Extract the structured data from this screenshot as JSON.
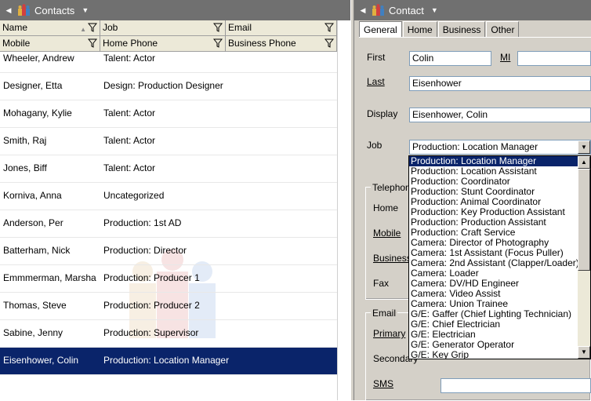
{
  "left": {
    "title": "Contacts",
    "header1": [
      {
        "label": "Name"
      },
      {
        "label": "Job"
      },
      {
        "label": "Email"
      }
    ],
    "header2": [
      {
        "label": "Mobile"
      },
      {
        "label": "Home Phone"
      },
      {
        "label": "Business Phone"
      }
    ],
    "rows": [
      {
        "name": "Wheeler, Andrew",
        "job": "Talent: Actor"
      },
      {
        "name": "Designer, Etta",
        "job": "Design: Production Designer"
      },
      {
        "name": "Mohagany, Kylie",
        "job": "Talent: Actor"
      },
      {
        "name": "Smith, Raj",
        "job": "Talent: Actor"
      },
      {
        "name": "Jones, Biff",
        "job": "Talent: Actor"
      },
      {
        "name": "Korniva, Anna",
        "job": "Uncategorized"
      },
      {
        "name": "Anderson, Per",
        "job": "Production: 1st AD"
      },
      {
        "name": "Batterham, Nick",
        "job": "Production: Director"
      },
      {
        "name": "Emmmerman, Marsha",
        "job": "Production: Producer 1"
      },
      {
        "name": "Thomas, Steve",
        "job": "Production: Producer 2"
      },
      {
        "name": "Sabine, Jenny",
        "job": "Production: Supervisor"
      },
      {
        "name": "Eisenhower, Colin",
        "job": "Production: Location Manager"
      }
    ],
    "selected_index": 11
  },
  "right": {
    "title": "Contact",
    "tabs": [
      "General",
      "Home",
      "Business",
      "Other"
    ],
    "active_tab": "General",
    "labels": {
      "first": "First",
      "mi": "MI",
      "last": "Last",
      "display": "Display",
      "job": "Job",
      "telephone": "Telephon",
      "home": "Home",
      "mobile": "Mobile",
      "business": "Business",
      "fax": "Fax",
      "email": "Email",
      "primary": "Primary",
      "secondary": "Secondary",
      "sms": "SMS"
    },
    "values": {
      "first": "Colin",
      "mi": "",
      "last": "Eisenhower",
      "display": "Eisenhower, Colin",
      "job": "Production: Location Manager"
    },
    "job_options": [
      "Production: Location Manager",
      "Production: Location Assistant",
      "Production: Coordinator",
      "Production: Stunt Coordinator",
      "Production: Animal Coordinator",
      "Production: Key Production Assistant",
      "Production: Production Assistant",
      "Production: Craft Service",
      "Camera: Director of Photography",
      "Camera: 1st Assistant (Focus Puller)",
      "Camera: 2nd Assistant (Clapper/Loader)",
      "Camera: Loader",
      "Camera: DV/HD Engineer",
      "Camera: Video Assist",
      "Camera: Union Trainee",
      "G/E: Gaffer (Chief Lighting Technician)",
      "G/E: Chief Electrician",
      "G/E: Electrician",
      "G/E: Generator Operator",
      "G/E: Key Grip"
    ],
    "highlighted_option": 0
  },
  "colors": {
    "titlebar": "#707070",
    "selection": "#0a246a",
    "panel": "#d4d0c8"
  }
}
